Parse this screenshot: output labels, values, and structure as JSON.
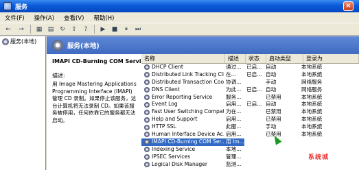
{
  "window": {
    "title": "服务",
    "close_glyph": "×"
  },
  "menu": [
    "文件(F)",
    "操作(A)",
    "查看(V)",
    "帮助(H)"
  ],
  "toolbar": {
    "back": "←",
    "forward": "→",
    "buttons": [
      "▦",
      "▤",
      "↻",
      "⇪",
      "?",
      "▶",
      "■",
      "⏸",
      "⏭"
    ]
  },
  "tree": {
    "root_label": "服务(本地)"
  },
  "right_header": {
    "title": "服务(本地)"
  },
  "description": {
    "service_name": "IMAPI CD-Burning COM Service",
    "label": "描述:",
    "text": "用 Image Mastering Applications Programming Interface (IMAPI) 管理 CD 录制。如果停止该服务，这台计算机将无法录制 CD。如果该服务被停用，任何依靠它的服务都无法启动。"
  },
  "list": {
    "columns": [
      "名称",
      "描述",
      "状态",
      "启动类型",
      "登录为"
    ],
    "rows": [
      {
        "name": "DHCP Client",
        "desc": "通过...",
        "state": "已启...",
        "startup": "自动",
        "logon": "本地系统"
      },
      {
        "name": "Distributed Link Tracking Cli...",
        "desc": "在...",
        "state": "已启...",
        "startup": "自动",
        "logon": "本地系统"
      },
      {
        "name": "Distributed Transaction Coo...",
        "desc": "协调...",
        "state": "",
        "startup": "手动",
        "logon": "网络服务"
      },
      {
        "name": "DNS Client",
        "desc": "为此...",
        "state": "已启...",
        "startup": "自动",
        "logon": "网络服务"
      },
      {
        "name": "Error Reporting Service",
        "desc": "服务...",
        "state": "",
        "startup": "已禁用",
        "logon": "本地系统"
      },
      {
        "name": "Event Log",
        "desc": "启用...",
        "state": "已启...",
        "startup": "自动",
        "logon": "本地系统"
      },
      {
        "name": "Fast User Switching Compat...",
        "desc": "为在...",
        "state": "",
        "startup": "已禁用",
        "logon": "本地系统"
      },
      {
        "name": "Help and Support",
        "desc": "启用...",
        "state": "",
        "startup": "已禁用",
        "logon": "本地系统"
      },
      {
        "name": "HTTP SSL",
        "desc": "此服...",
        "state": "",
        "startup": "手动",
        "logon": "本地系统"
      },
      {
        "name": "Human Interface Device Ac...",
        "desc": "启用...",
        "state": "",
        "startup": "已禁用",
        "logon": "本地系统"
      },
      {
        "name": "IMAPI CD-Burning COM Ser...",
        "desc": "用 Im...",
        "state": "",
        "startup": "",
        "logon": ""
      },
      {
        "name": "Indexing Service",
        "desc": "本地...",
        "state": "",
        "startup": "",
        "logon": ""
      },
      {
        "name": "IPSEC Services",
        "desc": "管理...",
        "state": "",
        "startup": "",
        "logon": ""
      },
      {
        "name": "Logical Disk Manager",
        "desc": "监测...",
        "state": "",
        "startup": "",
        "logon": ""
      }
    ],
    "selected_index": 10
  },
  "watermark": {
    "text": "系统城"
  },
  "colors": {
    "title_blue": "#0a5ad8",
    "header_blue": "#3e6ac0",
    "selection": "#316ac5"
  }
}
